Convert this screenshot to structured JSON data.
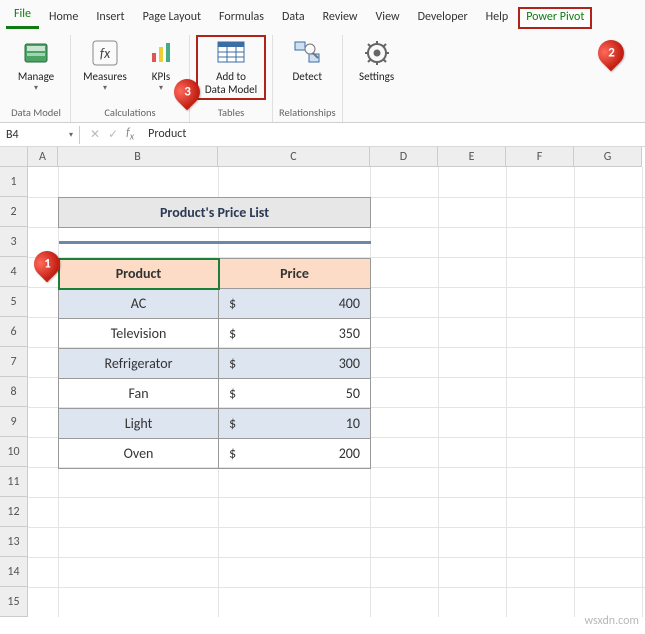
{
  "tabs": {
    "file": "File",
    "home": "Home",
    "insert": "Insert",
    "page_layout": "Page Layout",
    "formulas": "Formulas",
    "data": "Data",
    "review": "Review",
    "view": "View",
    "developer": "Developer",
    "help": "Help",
    "power_pivot": "Power Pivot"
  },
  "ribbon": {
    "data_model": {
      "manage": "Manage",
      "group": "Data Model"
    },
    "calculations": {
      "measures": "Measures",
      "kpis": "KPIs",
      "group": "Calculations"
    },
    "tables": {
      "add": "Add to\nData Model",
      "group": "Tables"
    },
    "relationships": {
      "detect": "Detect",
      "group": "Relationships"
    },
    "settings": {
      "settings": "Settings"
    }
  },
  "namebox": {
    "ref": "B4"
  },
  "formula_bar": {
    "value": "Product"
  },
  "columns": [
    "A",
    "B",
    "C",
    "D",
    "E",
    "F",
    "G"
  ],
  "rows": [
    "1",
    "2",
    "3",
    "4",
    "5",
    "6",
    "7",
    "8",
    "9",
    "10",
    "11",
    "12",
    "13",
    "14",
    "15"
  ],
  "sheet": {
    "title": "Product's Price List",
    "headers": {
      "product": "Product",
      "price": "Price"
    },
    "currency": "$",
    "data": [
      {
        "product": "AC",
        "price": 400
      },
      {
        "product": "Television",
        "price": 350
      },
      {
        "product": "Refrigerator",
        "price": 300
      },
      {
        "product": "Fan",
        "price": 50
      },
      {
        "product": "Light",
        "price": 10
      },
      {
        "product": "Oven",
        "price": 200
      }
    ]
  },
  "callouts": {
    "c1": "1",
    "c2": "2",
    "c3": "3"
  },
  "watermark": "wsxdn.com"
}
